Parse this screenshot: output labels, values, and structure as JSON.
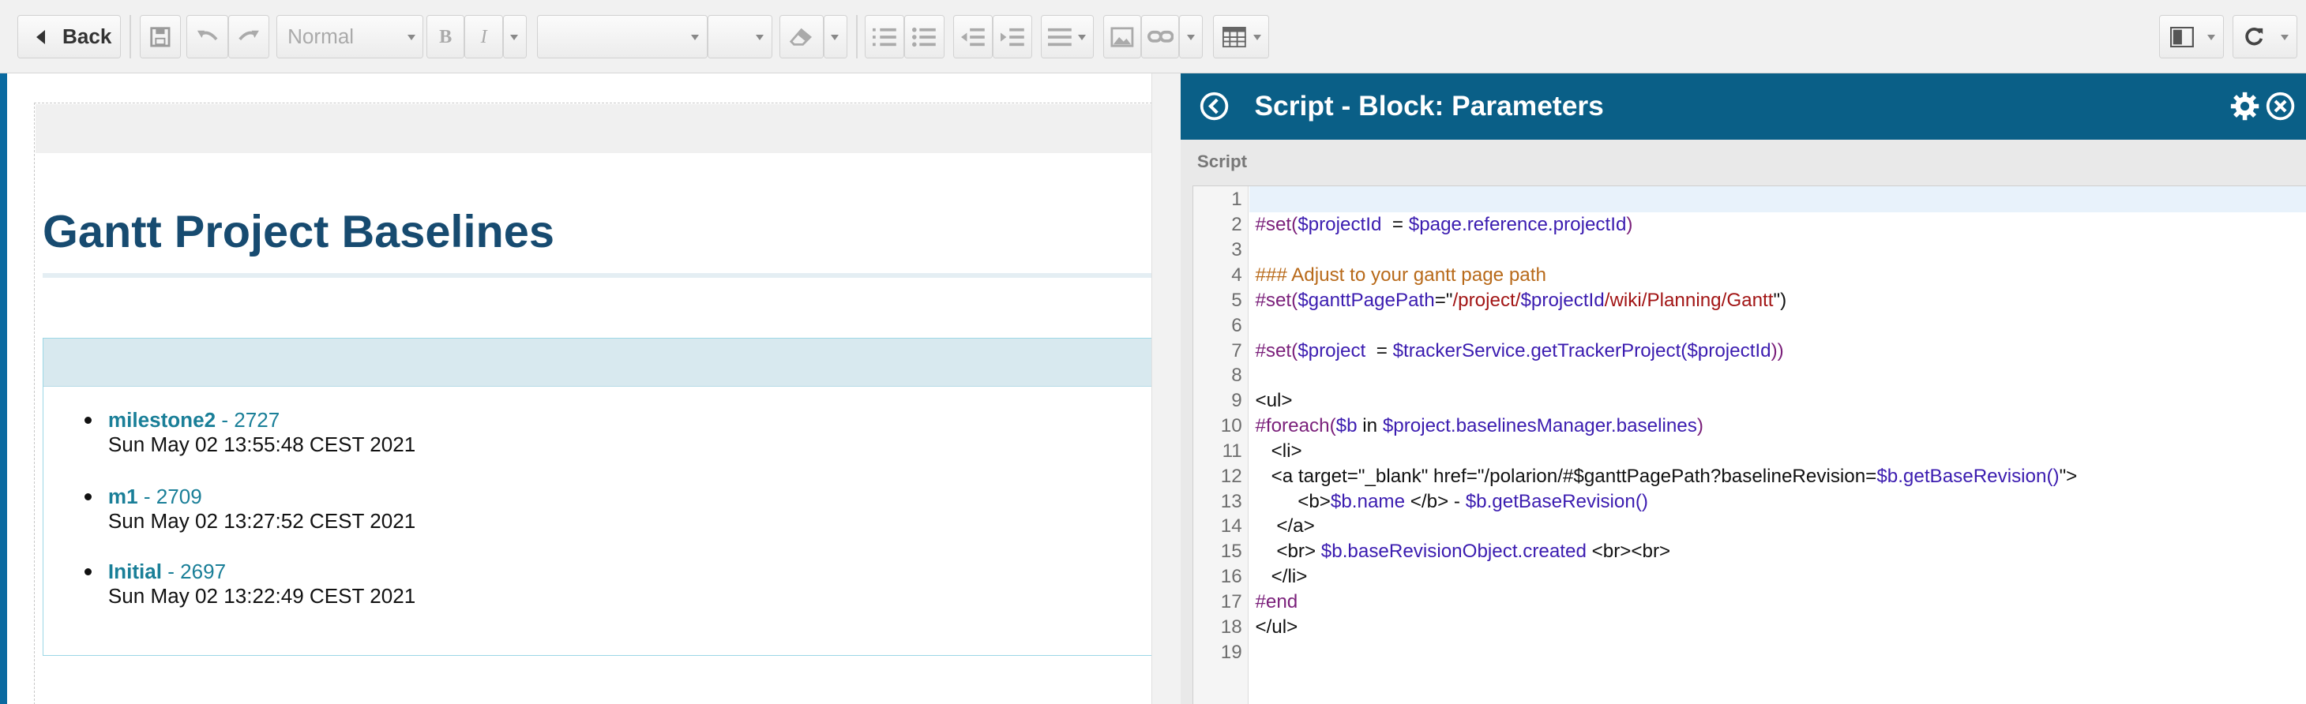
{
  "toolbar": {
    "back_label": "Back",
    "style_select": "Normal",
    "bold_label": "B",
    "italic_label": "I"
  },
  "page": {
    "title": "Gantt Project Baselines"
  },
  "baselines": [
    {
      "name": "milestone2",
      "revision": " - 2727",
      "created": "Sun May 02 13:55:48 CEST 2021"
    },
    {
      "name": "m1",
      "revision": " - 2709",
      "created": "Sun May 02 13:27:52 CEST 2021"
    },
    {
      "name": "Initial",
      "revision": " - 2697",
      "created": "Sun May 02 13:22:49 CEST 2021"
    }
  ],
  "panel": {
    "title": "Script - Block: Parameters",
    "section_label": "Script"
  },
  "editor": {
    "line_numbers": [
      "1",
      "2",
      "3",
      "4",
      "5",
      "6",
      "7",
      "8",
      "9",
      "10",
      "11",
      "12",
      "13",
      "14",
      "15",
      "16",
      "17",
      "18",
      "19"
    ],
    "lines": [
      [],
      [
        [
          "kw",
          "#set("
        ],
        [
          "vr",
          "$projectId"
        ],
        [
          "",
          "  = "
        ],
        [
          "vr",
          "$page.reference.projectId"
        ],
        [
          "kw",
          ")"
        ]
      ],
      [],
      [
        [
          "cm",
          "### Adjust to your gantt page path"
        ]
      ],
      [
        [
          "kw",
          "#set("
        ],
        [
          "vr",
          "$ganttPagePath"
        ],
        [
          "",
          "=\""
        ],
        [
          "st",
          "/project/"
        ],
        [
          "vr",
          "$projectId"
        ],
        [
          "st",
          "/wiki/Planning/Gantt"
        ],
        [
          "",
          "\")"
        ]
      ],
      [],
      [
        [
          "kw",
          "#set("
        ],
        [
          "vr",
          "$project"
        ],
        [
          "",
          "  = "
        ],
        [
          "vr",
          "$trackerService.getTrackerProject("
        ],
        [
          "vr",
          "$projectId"
        ],
        [
          "kw",
          "))"
        ]
      ],
      [],
      [
        [
          "",
          "<ul>"
        ]
      ],
      [
        [
          "kw",
          "#foreach("
        ],
        [
          "vr",
          "$b"
        ],
        [
          "",
          " in "
        ],
        [
          "vr",
          "$project.baselinesManager.baselines"
        ],
        [
          "kw",
          ")"
        ]
      ],
      [
        [
          "",
          "   <li>"
        ]
      ],
      [
        [
          "",
          "   <a target=\"_blank\" href=\"/polarion/#$ganttPagePath?baselineRevision="
        ],
        [
          "vr",
          "$b.getBaseRevision()"
        ],
        [
          "",
          "\">"
        ]
      ],
      [
        [
          "",
          "        <b>"
        ],
        [
          "vr",
          "$b.name"
        ],
        [
          "",
          " </b> - "
        ],
        [
          "vr",
          "$b.getBaseRevision()"
        ]
      ],
      [
        [
          "",
          "    </a>"
        ]
      ],
      [
        [
          "",
          "    <br> "
        ],
        [
          "vr",
          "$b.baseRevisionObject.created"
        ],
        [
          "",
          " <br><br>"
        ]
      ],
      [
        [
          "",
          "   </li>"
        ]
      ],
      [
        [
          "kw",
          "#end"
        ]
      ],
      [
        [
          "",
          "</ul>"
        ]
      ],
      []
    ]
  },
  "colors": {
    "accent": "#0a5f87",
    "title": "#174b70",
    "link": "#1a7f98"
  }
}
